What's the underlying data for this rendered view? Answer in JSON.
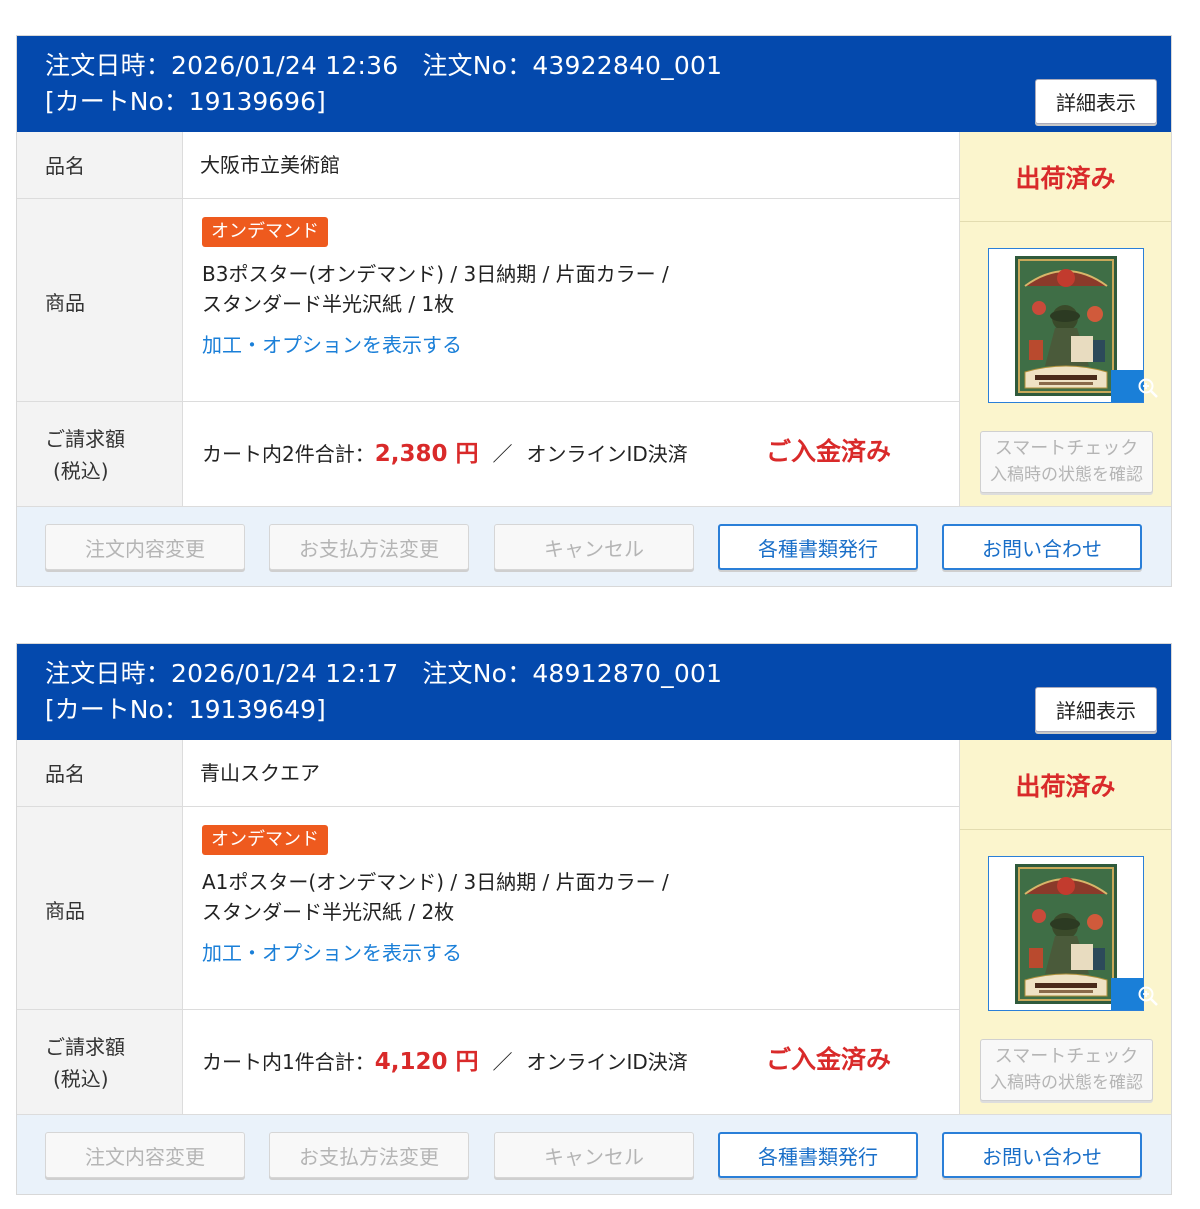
{
  "orders": [
    {
      "order_date_label": "注文日時：",
      "order_date": "2026/01/24 12:36",
      "order_no_label": "注文No：",
      "order_no": "43922840_001",
      "cart_no_text": "[カートNo：19139696]",
      "detail_button": "詳細表示",
      "name_label": "品名",
      "name_value": "大阪市立美術館",
      "product_label": "商品",
      "tag": "オンデマンド",
      "spec_line1": "B3ポスター(オンデマンド) / 3日納期 / 片面カラー /",
      "spec_line2": "スタンダード半光沢紙 / 1枚",
      "options_link": "加工・オプションを表示する",
      "price_label_1": "ご請求額",
      "price_label_2": "(税込)",
      "cart_total_label": "カート内2件合計：",
      "amount": "2,380 円",
      "separator": "／",
      "payment_method": "オンラインID決済",
      "payment_status": "ご入金済み",
      "shipping_status": "出荷済み",
      "smart_check_1": "スマートチェック",
      "smart_check_2": "入稿時の状態を確認",
      "buttons": [
        "注文内容変更",
        "お支払方法変更",
        "キャンセル",
        "各種書類発行",
        "お問い合わせ"
      ]
    },
    {
      "order_date_label": "注文日時：",
      "order_date": "2026/01/24 12:17",
      "order_no_label": "注文No：",
      "order_no": "48912870_001",
      "cart_no_text": "[カートNo：19139649]",
      "detail_button": "詳細表示",
      "name_label": "品名",
      "name_value": "青山スクエア",
      "product_label": "商品",
      "tag": "オンデマンド",
      "spec_line1": "A1ポスター(オンデマンド) / 3日納期 / 片面カラー /",
      "spec_line2": "スタンダード半光沢紙 / 2枚",
      "options_link": "加工・オプションを表示する",
      "price_label_1": "ご請求額",
      "price_label_2": "(税込)",
      "cart_total_label": "カート内1件合計：",
      "amount": "4,120 円",
      "separator": "／",
      "payment_method": "オンラインID決済",
      "payment_status": "ご入金済み",
      "shipping_status": "出荷済み",
      "smart_check_1": "スマートチェック",
      "smart_check_2": "入稿時の状態を確認",
      "buttons": [
        "注文内容変更",
        "お支払方法変更",
        "キャンセル",
        "各種書類発行",
        "お問い合わせ"
      ]
    }
  ],
  "colors": {
    "header_blue": "#0449ad",
    "status_red": "#d92a2a",
    "tag_orange": "#ee5a1e",
    "link_blue": "#1a7fd8",
    "side_yellow": "#fbf5cd",
    "footer_blue": "#eaf2fa"
  }
}
